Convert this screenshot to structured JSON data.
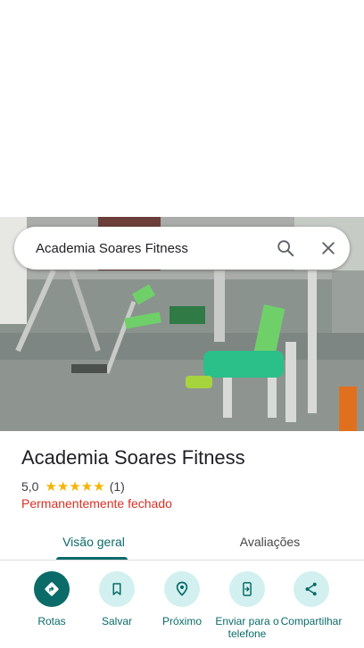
{
  "search": {
    "query": "Academia Soares Fitness"
  },
  "place": {
    "name": "Academia Soares Fitness",
    "rating": "5,0",
    "stars": "★★★★★",
    "review_count": "(1)",
    "status": "Permanentemente fechado"
  },
  "tabs": [
    {
      "label": "Visão geral",
      "active": true
    },
    {
      "label": "Avaliações",
      "active": false
    }
  ],
  "actions": [
    {
      "label": "Rotas",
      "icon": "directions-icon"
    },
    {
      "label": "Salvar",
      "icon": "bookmark-icon"
    },
    {
      "label": "Próximo",
      "icon": "nearby-icon"
    },
    {
      "label": "Enviar para o telefone",
      "icon": "send-to-phone-icon"
    },
    {
      "label": "Compartilhar",
      "icon": "share-icon"
    }
  ],
  "colors": {
    "accent": "#0b6b69",
    "accent_light": "#d2f0ef",
    "closed_status": "#d93025",
    "star": "#f5b400"
  }
}
